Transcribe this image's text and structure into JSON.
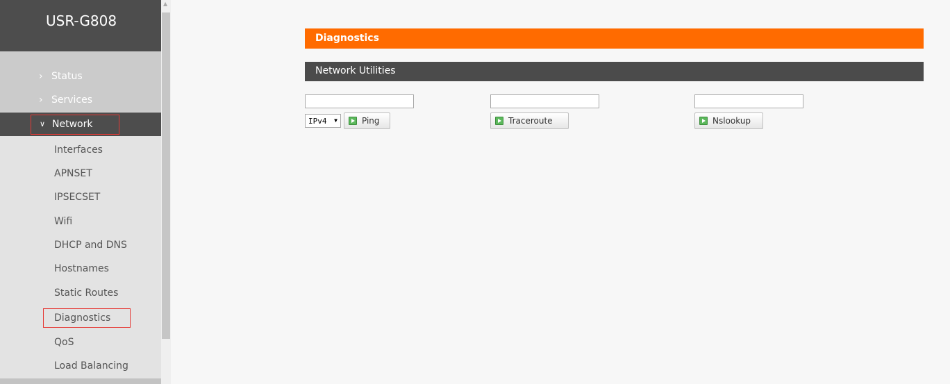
{
  "brand": "USR-G808",
  "sidebar": {
    "menu": [
      {
        "label": "Status",
        "chevron": "chevron-right-icon"
      },
      {
        "label": "Services",
        "chevron": "chevron-right-icon"
      },
      {
        "label": "Network",
        "chevron": "chevron-down-icon",
        "expanded": true
      }
    ],
    "network_items": [
      "Interfaces",
      "APNSET",
      "IPSECSET",
      "Wifi",
      "DHCP and DNS",
      "Hostnames",
      "Static Routes",
      "Diagnostics",
      "QoS",
      "Load Balancing"
    ],
    "selected": "Diagnostics"
  },
  "page": {
    "title": "Diagnostics",
    "section_title": "Network Utilities"
  },
  "tools": {
    "ping": {
      "host_value": "",
      "protocol": "IPv4",
      "button": "Ping"
    },
    "traceroute": {
      "host_value": "",
      "button": "Traceroute"
    },
    "nslookup": {
      "host_value": "",
      "button": "Nslookup"
    }
  },
  "colors": {
    "accent_orange": "#ff6b00",
    "header_dark": "#4b4b4b",
    "highlight_red": "#e53935",
    "button_icon_green": "#5cb85c"
  }
}
